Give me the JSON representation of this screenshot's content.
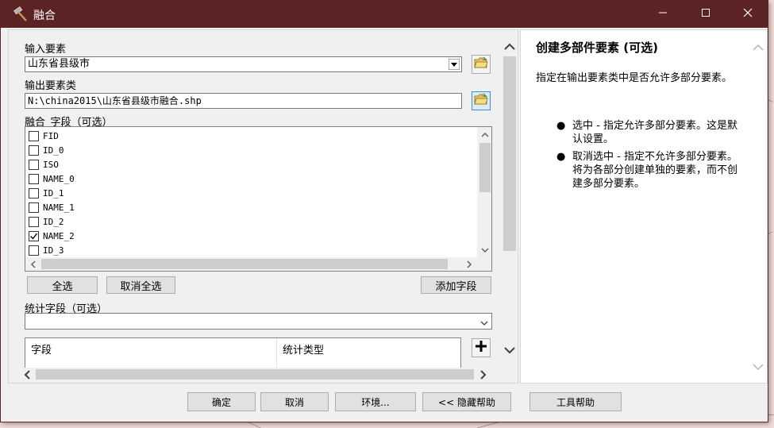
{
  "window": {
    "title": "融合",
    "controls": [
      "minimize-icon",
      "maximize-icon",
      "close-icon"
    ]
  },
  "form": {
    "input_label": "输入要素",
    "input_value": "山东省县级市",
    "output_label": "输出要素类",
    "output_value": "N:\\china2015\\山东省县级市融合.shp",
    "dissolve_label": "融合_字段（可选）",
    "fields": [
      {
        "name": "FID",
        "checked": false
      },
      {
        "name": "ID_0",
        "checked": false
      },
      {
        "name": "ISO",
        "checked": false
      },
      {
        "name": "NAME_0",
        "checked": false
      },
      {
        "name": "ID_1",
        "checked": false
      },
      {
        "name": "NAME_1",
        "checked": false
      },
      {
        "name": "ID_2",
        "checked": false
      },
      {
        "name": "NAME_2",
        "checked": true
      },
      {
        "name": "ID_3",
        "checked": false
      }
    ],
    "select_all": "全选",
    "clear_all": "取消全选",
    "add_field": "添加字段",
    "stats_label": "统计字段（可选）",
    "stats_value": "",
    "table_headers": [
      "字段",
      "统计类型"
    ]
  },
  "help": {
    "title": "创建多部件要素 (可选)",
    "description": "指定在输出要素类中是否允许多部分要素。",
    "bullets": [
      "选中 - 指定允许多部分要素。这是默认设置。",
      "取消选中 - 指定不允许多部分要素。将为各部分创建单独的要素，而不创建多部分要素。"
    ]
  },
  "buttons": {
    "ok": "确定",
    "cancel": "取消",
    "env": "环境...",
    "hide_help": "<< 隐藏帮助",
    "tool_help": "工具帮助"
  },
  "colors": {
    "titlebar": "#5b2323",
    "map": "#f3dcd9",
    "focus": "#3b8ed9"
  }
}
